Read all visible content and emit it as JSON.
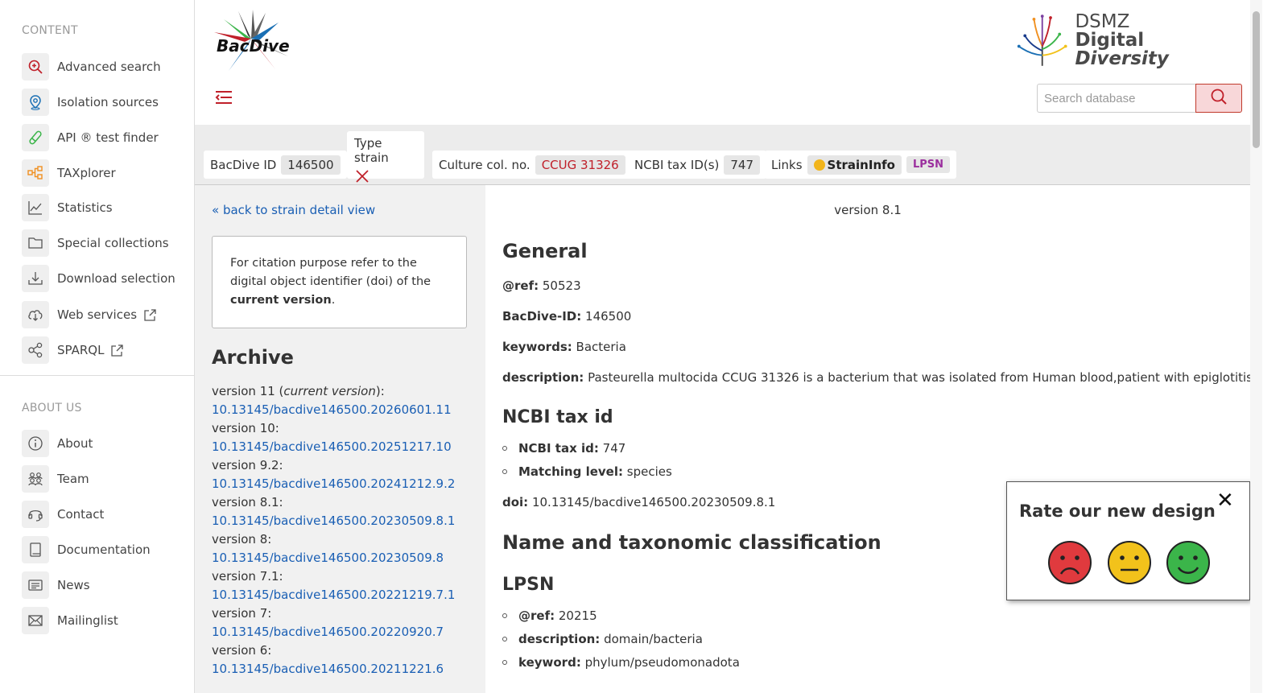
{
  "sidebar": {
    "content_label": "CONTENT",
    "about_label": "ABOUT US",
    "content_items": [
      {
        "label": "Advanced search",
        "icon": "magnify-plus-icon"
      },
      {
        "label": "Isolation sources",
        "icon": "location-pin-icon"
      },
      {
        "label": "API ® test finder",
        "icon": "test-tube-icon"
      },
      {
        "label": "TAXplorer",
        "icon": "hierarchy-icon"
      },
      {
        "label": "Statistics",
        "icon": "line-chart-icon"
      },
      {
        "label": "Special collections",
        "icon": "folder-icon"
      },
      {
        "label": "Download selection",
        "icon": "download-icon"
      },
      {
        "label": "Web services",
        "icon": "cloud-download-icon"
      },
      {
        "label": "SPARQL",
        "icon": "share-nodes-icon"
      }
    ],
    "about_items": [
      {
        "label": "About",
        "icon": "info-icon"
      },
      {
        "label": "Team",
        "icon": "team-icon"
      },
      {
        "label": "Contact",
        "icon": "headset-icon"
      },
      {
        "label": "Documentation",
        "icon": "book-icon"
      },
      {
        "label": "News",
        "icon": "newspaper-icon"
      },
      {
        "label": "Mailinglist",
        "icon": "envelope-icon"
      }
    ]
  },
  "header": {
    "logo_text": "BacDive",
    "dsmz_top": "DSMZ",
    "dsmz_bottom_a": "Digital ",
    "dsmz_bottom_b": "Diversity",
    "search_placeholder": "Search database"
  },
  "infobar": {
    "bacdive_id_label": "BacDive ID",
    "bacdive_id": "146500",
    "type_strain_label": "Type strain",
    "culture_label": "Culture col. no.",
    "culture_no": "CCUG 31326",
    "ncbi_label": "NCBI tax ID(s)",
    "ncbi_id": "747",
    "links_label": "Links",
    "straininfo": "StrainInfo",
    "lpsn": "LPSN"
  },
  "left": {
    "back_link": "« back to strain detail view",
    "cite_text_1": "For citation purpose refer to the digital object identifier (doi) of the ",
    "cite_bold": "current version",
    "cite_text_2": ".",
    "archive_title": "Archive",
    "versions": [
      {
        "label_a": "version 11 (",
        "label_i": "current version",
        "label_b": "):",
        "doi": "10.13145/bacdive146500.20260601.11"
      },
      {
        "label_a": "version 10:",
        "label_i": "",
        "label_b": "",
        "doi": "10.13145/bacdive146500.20251217.10"
      },
      {
        "label_a": "version 9.2:",
        "label_i": "",
        "label_b": "",
        "doi": "10.13145/bacdive146500.20241212.9.2"
      },
      {
        "label_a": "version 8.1:",
        "label_i": "",
        "label_b": "",
        "doi": "10.13145/bacdive146500.20230509.8.1"
      },
      {
        "label_a": "version 8:",
        "label_i": "",
        "label_b": "",
        "doi": "10.13145/bacdive146500.20230509.8"
      },
      {
        "label_a": "version 7.1:",
        "label_i": "",
        "label_b": "",
        "doi": "10.13145/bacdive146500.20221219.7.1"
      },
      {
        "label_a": "version 7:",
        "label_i": "",
        "label_b": "",
        "doi": "10.13145/bacdive146500.20220920.7"
      },
      {
        "label_a": "version 6:",
        "label_i": "",
        "label_b": "",
        "doi": "10.13145/bacdive146500.20211221.6"
      }
    ]
  },
  "main": {
    "version_label": "version 8.1",
    "general_title": "General",
    "ref_key": "@ref:",
    "ref_val": "50523",
    "bacdive_id_key": "BacDive-ID:",
    "bacdive_id_val": "146500",
    "keywords_key": "keywords:",
    "keywords_val": "Bacteria",
    "description_key": "description:",
    "description_val": "Pasteurella multocida CCUG 31326 is a bacterium that was isolated from Human blood,patient with epiglotitis.",
    "ncbi_title": "NCBI tax id",
    "ncbi_taxid_key": "NCBI tax id:",
    "ncbi_taxid_val": "747",
    "matching_key": "Matching level:",
    "matching_val": "species",
    "doi_key": "doi:",
    "doi_val": "10.13145/bacdive146500.20230509.8.1",
    "name_title": "Name and taxonomic classification",
    "lpsn_title": "LPSN",
    "lpsn_ref_key": "@ref:",
    "lpsn_ref_val": "20215",
    "lpsn_desc_key": "description:",
    "lpsn_desc_val": "domain/bacteria",
    "lpsn_keyword_key": "keyword:",
    "lpsn_keyword_val": "phylum/pseudomonadota"
  },
  "rating": {
    "title": "Rate our new design",
    "close": "✕"
  },
  "colors": {
    "accent_red": "#c0202a",
    "link_blue": "#1a5fb4",
    "sad": "#e03a3e",
    "neutral": "#f2c21b",
    "happy": "#3bb54a"
  }
}
